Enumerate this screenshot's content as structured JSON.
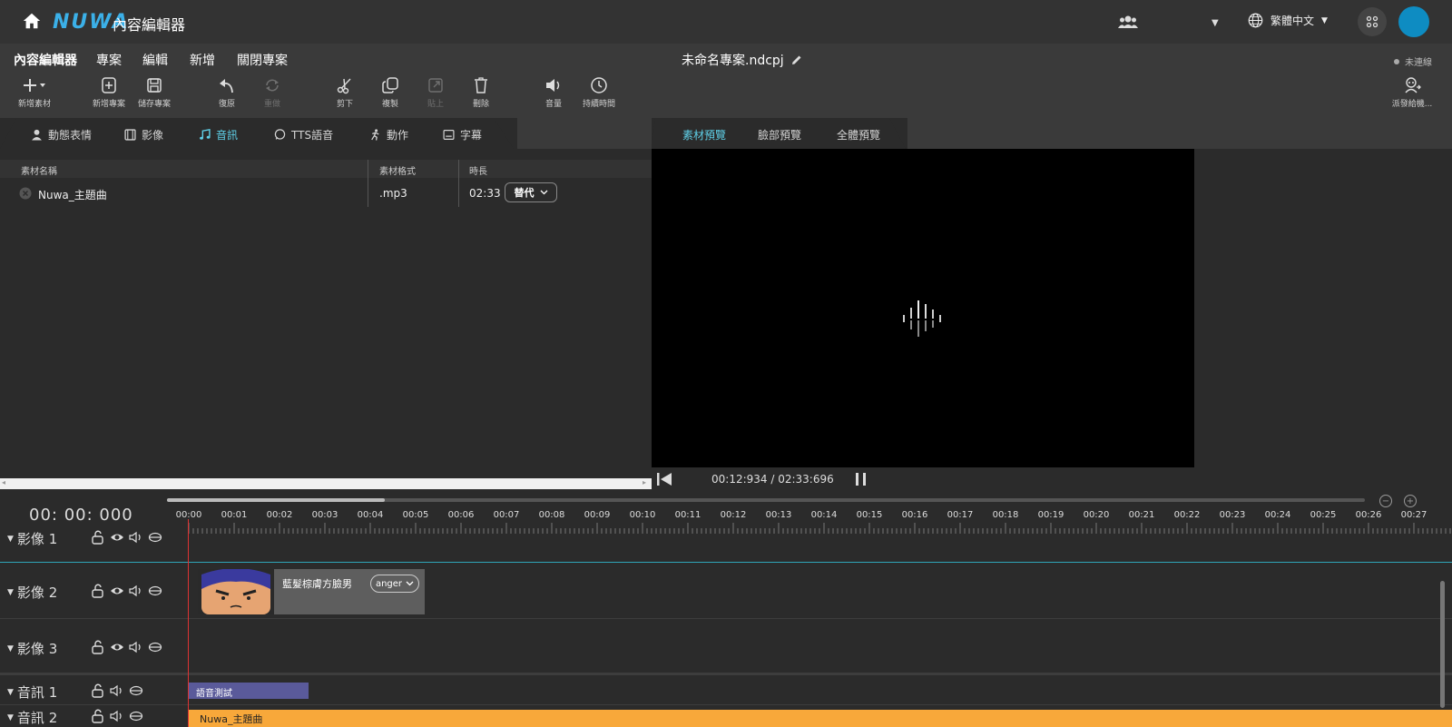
{
  "header": {
    "logo": "NUWA",
    "title": "內容編輯器",
    "language": "繁體中文",
    "accent_color": "#3bb0e8",
    "avatar_color": "#0e8cc2"
  },
  "menu": {
    "items": [
      "內容編輯器",
      "專案",
      "編輯",
      "新增",
      "關閉專案"
    ],
    "project_name": "未命名專案.ndcpj",
    "connection_status": "未連線"
  },
  "toolbar": {
    "add_asset": "新增素材",
    "new_project": "新增專案",
    "save_project": "儲存專案",
    "undo": "復原",
    "redo": "重做",
    "cut": "剪下",
    "copy": "複製",
    "paste": "貼上",
    "delete": "刪除",
    "volume": "音量",
    "duration": "持續時間",
    "send_to_robot": "派發給機..."
  },
  "asset_tabs": [
    {
      "label": "動態表情",
      "icon": "person-icon"
    },
    {
      "label": "影像",
      "icon": "film-icon"
    },
    {
      "label": "音訊",
      "icon": "music-icon",
      "active": true
    },
    {
      "label": "TTS語音",
      "icon": "speech-icon"
    },
    {
      "label": "動作",
      "icon": "run-icon"
    },
    {
      "label": "字幕",
      "icon": "subtitle-icon"
    }
  ],
  "preview_tabs": [
    {
      "label": "素材預覽",
      "active": true
    },
    {
      "label": "臉部預覽"
    },
    {
      "label": "全體預覽"
    }
  ],
  "asset_table": {
    "columns": [
      "素材名稱",
      "素材格式",
      "時長"
    ],
    "rows": [
      {
        "name": "Nuwa_主題曲",
        "format": ".mp3",
        "duration": "02:33",
        "action": "替代"
      }
    ]
  },
  "preview": {
    "time_readout": "00:12:934 / 02:33:696"
  },
  "timeline": {
    "timecode": "00: 00: 000",
    "ticks": [
      "00:00",
      "00:01",
      "00:02",
      "00:03",
      "00:04",
      "00:05",
      "00:06",
      "00:07",
      "00:08",
      "00:09",
      "00:10",
      "00:11",
      "00:12",
      "00:13",
      "00:14",
      "00:15",
      "00:16",
      "00:17",
      "00:18",
      "00:19",
      "00:20",
      "00:21",
      "00:22",
      "00:23",
      "00:24",
      "00:25",
      "00:26",
      "00:27"
    ],
    "tracks": [
      {
        "label": "影像 1"
      },
      {
        "label": "影像 2"
      },
      {
        "label": "影像 3"
      },
      {
        "label": "音訊 1"
      },
      {
        "label": "音訊 2"
      }
    ],
    "clips": {
      "face_name": "藍髮棕膚方臉男",
      "face_mood": "anger",
      "audio1_name": "語音測試",
      "audio2_name": "Nuwa_主題曲"
    }
  }
}
